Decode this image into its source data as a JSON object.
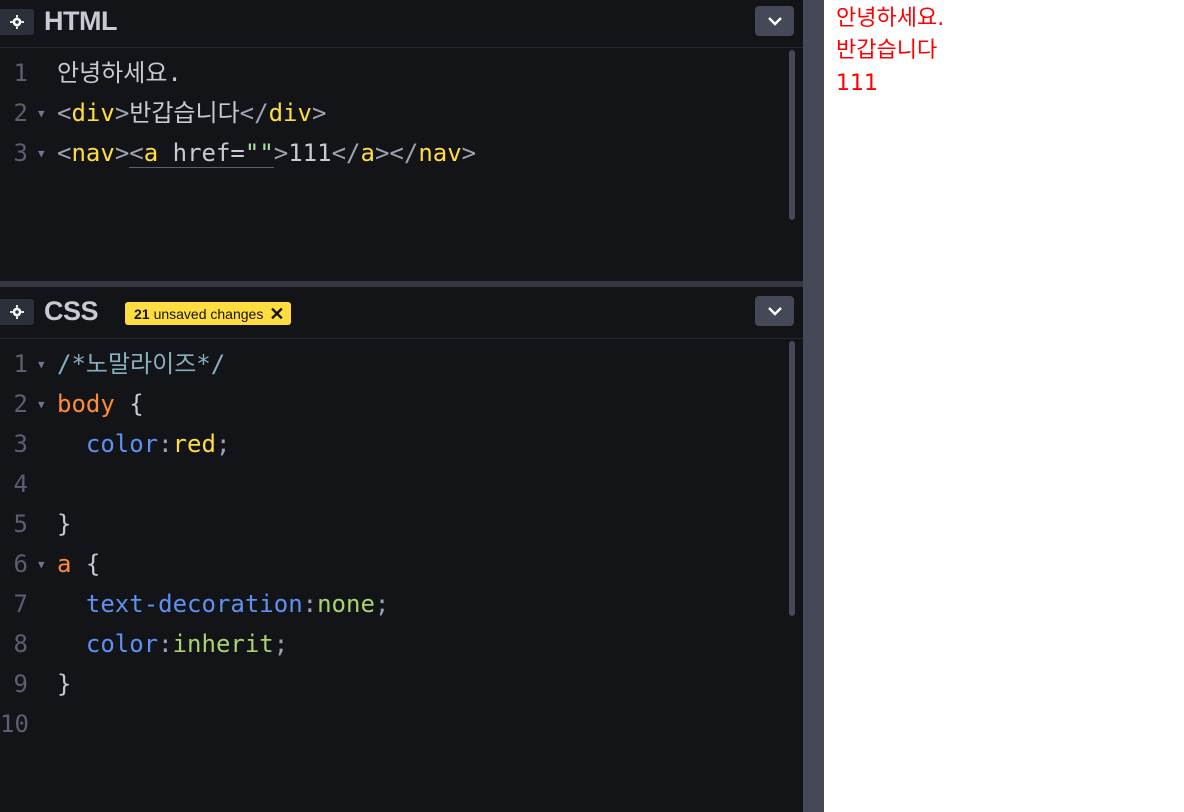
{
  "html_panel": {
    "title": "HTML",
    "lines": [
      {
        "num": "1",
        "parts": [
          {
            "t": "안녕하세요.",
            "c": "c-text"
          }
        ]
      },
      {
        "num": "2",
        "parts": [
          {
            "t": "<",
            "c": "c-punc"
          },
          {
            "t": "div",
            "c": "c-tag"
          },
          {
            "t": ">",
            "c": "c-punc"
          },
          {
            "t": "반갑습니다",
            "c": "c-text"
          },
          {
            "t": "</",
            "c": "c-punc"
          },
          {
            "t": "div",
            "c": "c-tag"
          },
          {
            "t": ">",
            "c": "c-punc"
          }
        ]
      },
      {
        "num": "3",
        "parts": [
          {
            "t": "<",
            "c": "c-punc"
          },
          {
            "t": "nav",
            "c": "c-tag"
          },
          {
            "t": ">",
            "c": "c-punc"
          },
          {
            "t": "<",
            "c": "c-punc"
          },
          {
            "t": "a",
            "c": "c-tag"
          },
          {
            "t": " href=",
            "c": "c-attr"
          },
          {
            "t": "\"\"",
            "c": "c-str"
          },
          {
            "t": ">",
            "c": "c-punc"
          },
          {
            "t": "111",
            "c": "c-text"
          },
          {
            "t": "</",
            "c": "c-punc"
          },
          {
            "t": "a",
            "c": "c-tag"
          },
          {
            "t": "></",
            "c": "c-punc"
          },
          {
            "t": "nav",
            "c": "c-tag"
          },
          {
            "t": ">",
            "c": "c-punc"
          }
        ]
      }
    ]
  },
  "css_panel": {
    "title": "CSS",
    "unsaved_badge": {
      "count": "21",
      "label": "unsaved changes",
      "close": "✕"
    },
    "lines": [
      {
        "num": "1",
        "parts": [
          {
            "t": "/*노말라이즈*/",
            "c": "c-cmt"
          }
        ]
      },
      {
        "num": "2",
        "parts": [
          {
            "t": "body",
            "c": "c-sel"
          },
          {
            "t": " {",
            "c": "c-brace"
          }
        ]
      },
      {
        "num": "3",
        "parts": [
          {
            "t": "  color",
            "c": "c-prop"
          },
          {
            "t": ":",
            "c": "c-punc"
          },
          {
            "t": "red",
            "c": "c-val"
          },
          {
            "t": ";",
            "c": "c-punc"
          }
        ]
      },
      {
        "num": "4",
        "parts": []
      },
      {
        "num": "5",
        "parts": [
          {
            "t": "}",
            "c": "c-brace"
          }
        ]
      },
      {
        "num": "6",
        "parts": [
          {
            "t": "a",
            "c": "c-sel"
          },
          {
            "t": " {",
            "c": "c-brace"
          }
        ]
      },
      {
        "num": "7",
        "parts": [
          {
            "t": "  text-decoration",
            "c": "c-prop"
          },
          {
            "t": ":",
            "c": "c-punc"
          },
          {
            "t": "none",
            "c": "c-kw"
          },
          {
            "t": ";",
            "c": "c-punc"
          }
        ]
      },
      {
        "num": "8",
        "parts": [
          {
            "t": "  color",
            "c": "c-prop"
          },
          {
            "t": ":",
            "c": "c-punc"
          },
          {
            "t": "inherit",
            "c": "c-kw"
          },
          {
            "t": ";",
            "c": "c-punc"
          }
        ]
      },
      {
        "num": "9",
        "parts": [
          {
            "t": "}",
            "c": "c-brace"
          }
        ]
      },
      {
        "num": "10",
        "parts": []
      }
    ]
  },
  "preview": {
    "lines": [
      "안녕하세요.",
      "반갑습니다",
      "111"
    ],
    "text_color": "#ff0000"
  },
  "icons": {
    "settings": "gear-icon",
    "collapse": "chevron-down-icon",
    "close": "close-icon",
    "fold": "fold-arrow-icon"
  }
}
